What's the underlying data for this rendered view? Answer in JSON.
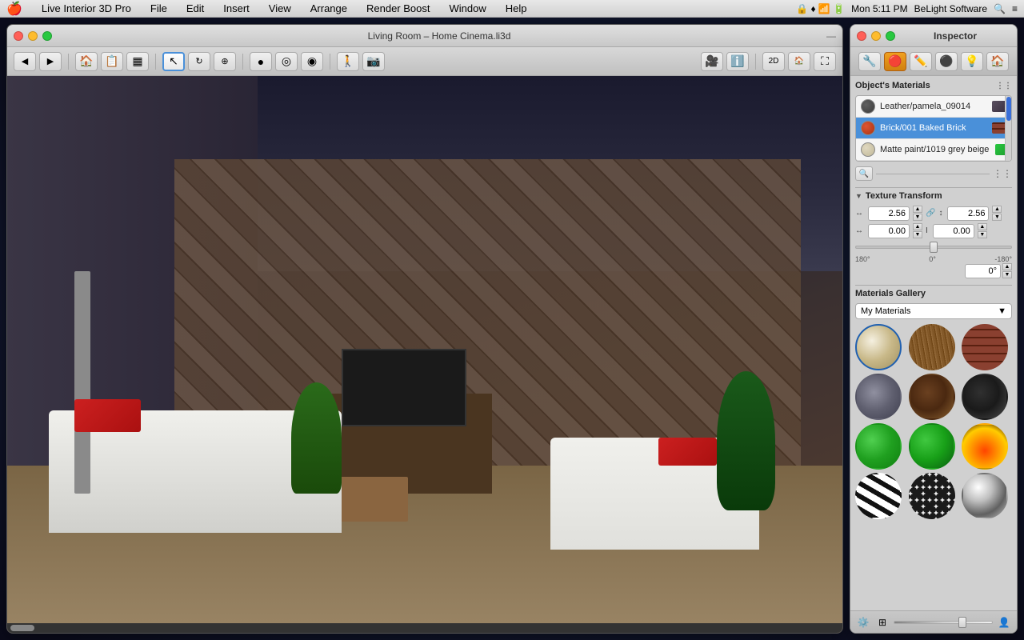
{
  "menubar": {
    "apple": "🍎",
    "app_name": "Live Interior 3D Pro",
    "menus": [
      "File",
      "Edit",
      "Insert",
      "View",
      "Arrange",
      "Render Boost",
      "Window",
      "Help"
    ],
    "right_info": "Mon 5:11 PM",
    "brand": "BeLight Software"
  },
  "window": {
    "title": "Living Room – Home Cinema.li3d",
    "traffic_lights": [
      "close",
      "minimize",
      "maximize"
    ]
  },
  "inspector": {
    "title": "Inspector",
    "tabs": [
      "object",
      "material-ball",
      "paint-brush",
      "material-sphere",
      "lightbulb",
      "house"
    ],
    "objects_materials_label": "Object's Materials",
    "materials": [
      {
        "name": "Leather/pamela_09014",
        "color": "#4a4a4a",
        "selected": false
      },
      {
        "name": "Brick/001 Baked Brick",
        "color": "#cc4422",
        "selected": true
      },
      {
        "name": "Matte paint/1019 grey beige",
        "color": "#d4c8a8",
        "selected": false
      }
    ],
    "texture_transform_label": "Texture Transform",
    "transform": {
      "scale_x": "2.56",
      "scale_y": "2.56",
      "offset_x": "0.00",
      "offset_y": "0.00",
      "rotation": "0°",
      "rotation_min": "180°",
      "rotation_center": "0°",
      "rotation_max": "-180°"
    },
    "gallery_label": "Materials Gallery",
    "gallery_dropdown": "My Materials",
    "gallery_dropdown_arrow": "▼",
    "material_balls": [
      {
        "id": "cream",
        "class": "mat-cream",
        "label": "Cream fabric"
      },
      {
        "id": "wood1",
        "class": "mat-wood1",
        "label": "Light wood"
      },
      {
        "id": "brick",
        "class": "mat-brick",
        "label": "Brick"
      },
      {
        "id": "stone",
        "class": "mat-stone",
        "label": "Stone"
      },
      {
        "id": "wood2",
        "class": "mat-wood2",
        "label": "Dark wood"
      },
      {
        "id": "dark",
        "class": "mat-dark",
        "label": "Dark material"
      },
      {
        "id": "green1",
        "class": "mat-green1",
        "label": "Green 1"
      },
      {
        "id": "green2",
        "class": "mat-green2",
        "label": "Green 2"
      },
      {
        "id": "fire",
        "class": "mat-fire",
        "label": "Fire"
      },
      {
        "id": "zebra",
        "class": "mat-zebra",
        "label": "Zebra"
      },
      {
        "id": "spots",
        "class": "mat-spots",
        "label": "Spots"
      },
      {
        "id": "chrome",
        "class": "mat-chrome",
        "label": "Chrome"
      }
    ]
  }
}
